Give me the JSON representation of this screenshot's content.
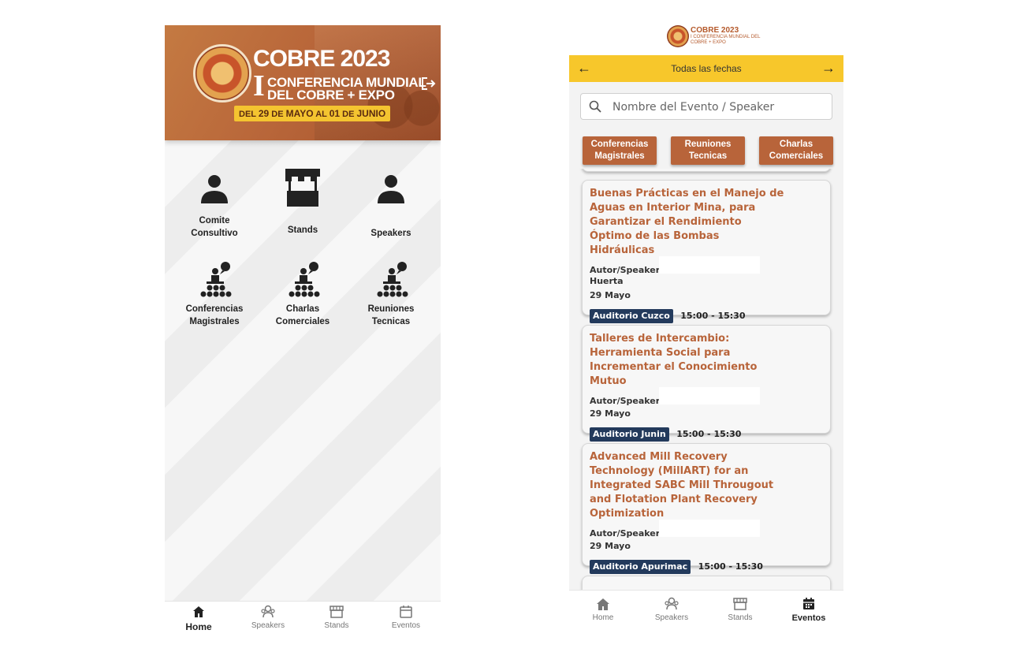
{
  "left": {
    "banner": {
      "title": "COBRE 2023",
      "roman": "I",
      "subtitle_line1": "CONFERENCIA MUNDIAL",
      "subtitle_line2": "DEL COBRE + EXPO",
      "dates_prefix": "DEL",
      "dates_day1": "29",
      "dates_mid1": "DE",
      "dates_month1": "MAYO",
      "dates_mid2": "AL",
      "dates_day2": "01",
      "dates_mid3": "DE",
      "dates_month2": "JUNIO"
    },
    "menu": [
      {
        "label_line1": "Comite",
        "label_line2": "Consultivo",
        "icon": "person-icon"
      },
      {
        "label_line1": "Stands",
        "label_line2": "",
        "icon": "store-icon"
      },
      {
        "label_line1": "Speakers",
        "label_line2": "",
        "icon": "person-icon"
      },
      {
        "label_line1": "Conferencias",
        "label_line2": "Magistrales",
        "icon": "audience-icon"
      },
      {
        "label_line1": "Charlas",
        "label_line2": "Comerciales",
        "icon": "audience-icon"
      },
      {
        "label_line1": "Reuniones",
        "label_line2": "Tecnicas",
        "icon": "audience-icon"
      }
    ],
    "nav": [
      {
        "label": "Home",
        "active": true
      },
      {
        "label": "Speakers",
        "active": false
      },
      {
        "label": "Stands",
        "active": false
      },
      {
        "label": "Eventos",
        "active": false
      }
    ]
  },
  "right": {
    "header": {
      "brand": "COBRE 2023",
      "brand_sub": "I CONFERENCIA MUNDIAL DEL COBRE + EXPO"
    },
    "date_filter": {
      "label": "Todas las fechas",
      "prev_arrow": "←",
      "next_arrow": "→"
    },
    "search": {
      "placeholder": "Nombre del Evento / Speaker"
    },
    "categories": [
      {
        "line1": "Conferencias",
        "line2": "Magistrales"
      },
      {
        "line1": "Reuniones",
        "line2": "Tecnicas"
      },
      {
        "line1": "Charlas",
        "line2": "Comerciales"
      }
    ],
    "events": [
      {
        "title": "Buenas Prácticas en el Manejo de Aguas en Interior Mina, para Garantizar el Rendimiento Óptimo de las Bombas Hidráulicas",
        "speaker_label": "Autor/Speaker:",
        "speaker_extra": "Huerta",
        "date": "29 Mayo",
        "room": "Auditorio Cuzco",
        "time": "15:00 - 15:30"
      },
      {
        "title": "Talleres de Intercambio: Herramienta Social para Incrementar el Conocimiento Mutuo",
        "speaker_label": "Autor/Speaker:",
        "speaker_extra": "",
        "date": "29 Mayo",
        "room": "Auditorio Junin",
        "time": "15:00 - 15:30"
      },
      {
        "title": "Advanced Mill Recovery Technology (MillART) for an Integrated SABC Mill Througout and Flotation Plant Recovery Optimization",
        "speaker_label": "Autor/Speaker:",
        "speaker_extra": "",
        "date": "29 Mayo",
        "room": "Auditorio Apurimac",
        "time": "15:00 - 15:30"
      }
    ],
    "nav": [
      {
        "label": "Home",
        "active": false
      },
      {
        "label": "Speakers",
        "active": false
      },
      {
        "label": "Stands",
        "active": false
      },
      {
        "label": "Eventos",
        "active": true
      }
    ]
  },
  "colors": {
    "brand_copper": "#b8643a",
    "date_bar_yellow": "#f7c72b",
    "room_badge_navy": "#233a5c"
  }
}
